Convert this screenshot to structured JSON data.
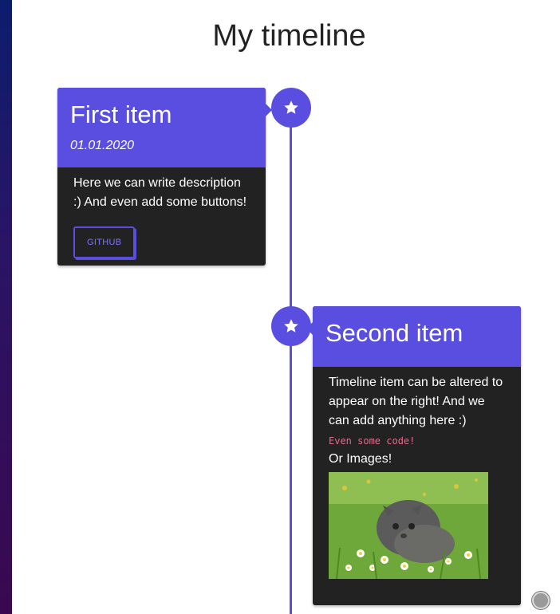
{
  "page": {
    "title": "My timeline"
  },
  "items": [
    {
      "title": "First item",
      "date": "01.01.2020",
      "description": "Here we can write description :) And even add some buttons!",
      "button_label": "GITHUB",
      "icon": "star-icon"
    },
    {
      "title": "Second item",
      "description": "Timeline item can be altered to appear on the right! And we can add anything here :)",
      "code": "Even some code!",
      "images_label": "Or Images!",
      "icon": "star-icon"
    }
  ],
  "colors": {
    "accent": "#5a4ee0",
    "card_body": "#222222",
    "code": "#e36a8a"
  }
}
